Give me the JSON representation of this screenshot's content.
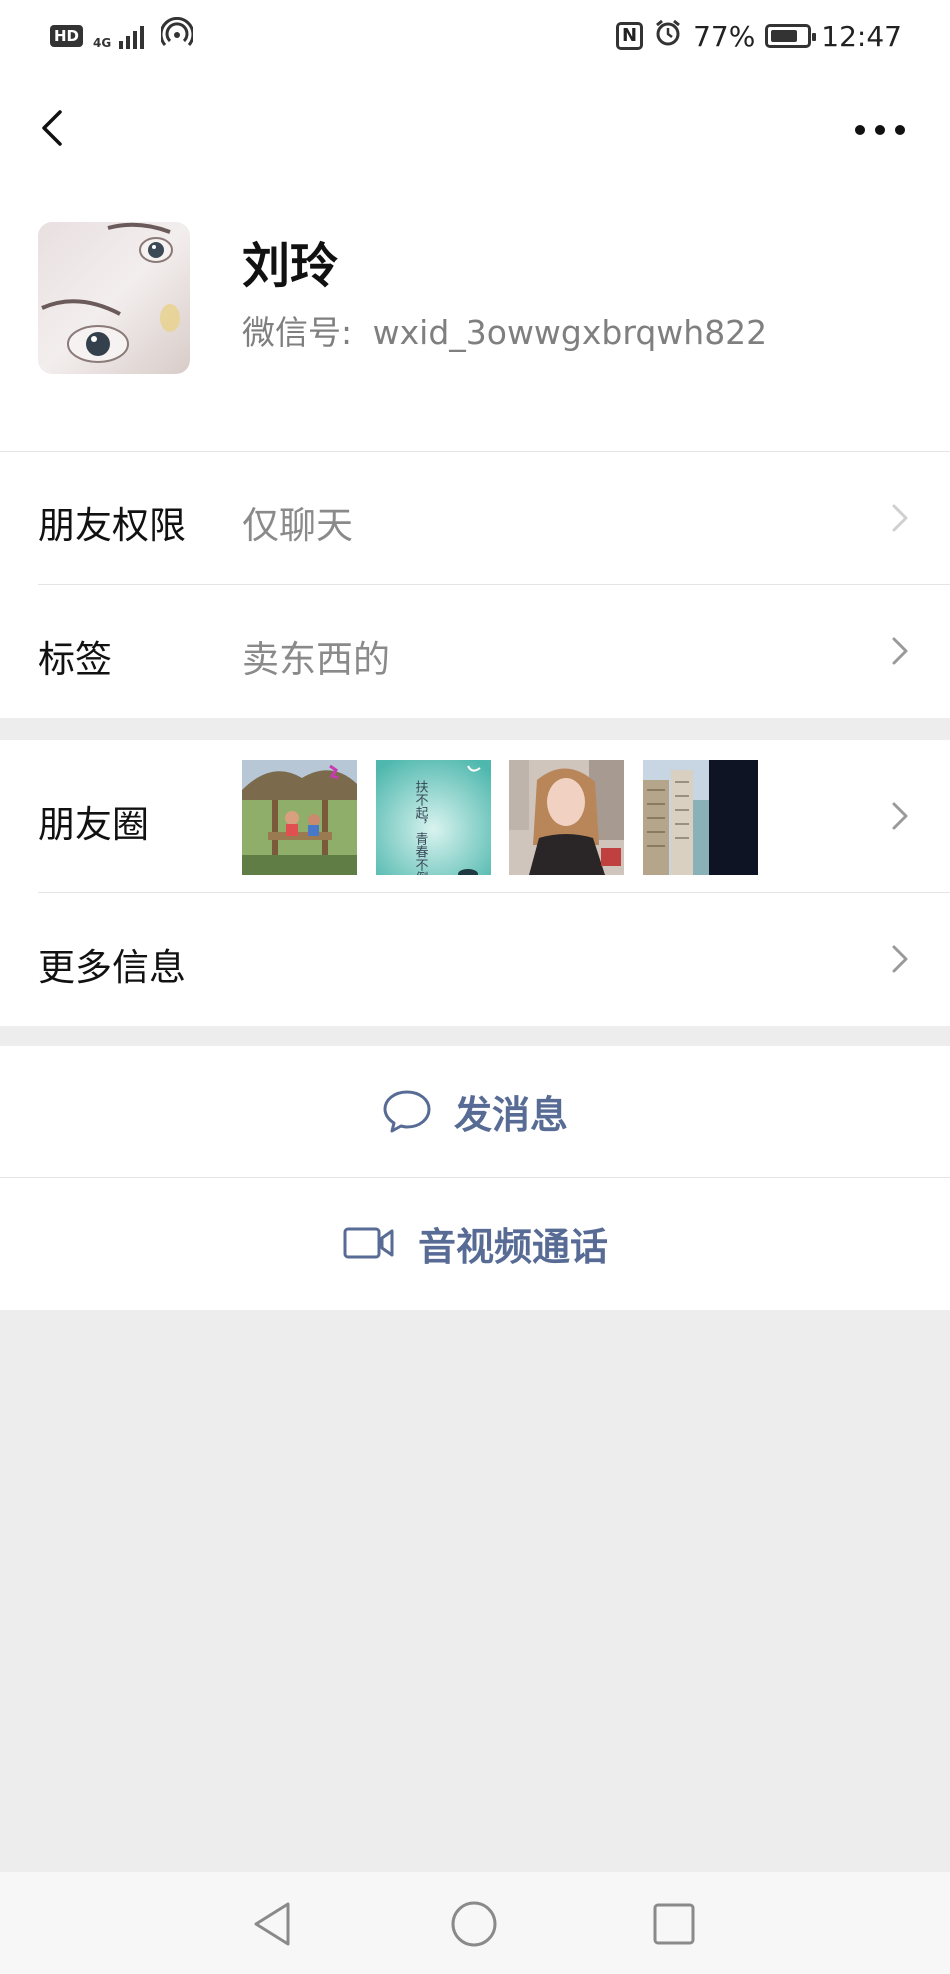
{
  "status_bar": {
    "hd": "HD",
    "network": "4G",
    "battery_percent": "77%",
    "battery_level": 0.77,
    "time": "12:47",
    "icons": [
      "hd-icon",
      "signal-icon",
      "hotspot-icon",
      "nfc-icon",
      "alarm-icon",
      "battery-icon"
    ]
  },
  "nav": {
    "back_icon": "chevron-left-icon",
    "more_icon": "more-dots-icon"
  },
  "profile": {
    "name": "刘玲",
    "wxid_label": "微信号:",
    "wxid_value": "wxid_3owwgxbrqwh822"
  },
  "rows": {
    "permission": {
      "label": "朋友权限",
      "value": "仅聊天"
    },
    "tags": {
      "label": "标签",
      "value": "卖东西的"
    },
    "moments": {
      "label": "朋友圈",
      "thumb_overlay_text": "扶不起，青春不倒。"
    },
    "more_info": {
      "label": "更多信息"
    }
  },
  "actions": {
    "message": {
      "label": "发消息",
      "icon": "chat-bubble-icon"
    },
    "call": {
      "label": "音视频通话",
      "icon": "video-camera-icon"
    }
  },
  "colors": {
    "link_blue": "#576b95",
    "page_bg": "#ededed",
    "card_bg": "#ffffff",
    "secondary_text": "#8a8a8a"
  },
  "system_nav": [
    "back-triangle-icon",
    "home-circle-icon",
    "recents-square-icon"
  ]
}
